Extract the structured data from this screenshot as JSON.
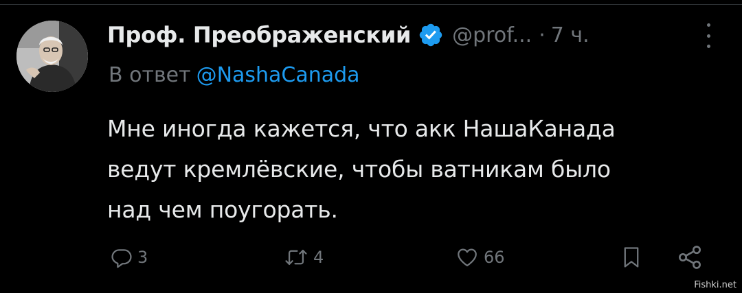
{
  "author": {
    "display_name": "Проф. Преображенский",
    "handle": "@prof...",
    "separator": "·",
    "time_ago": "7 ч.",
    "verified_badge_color": "#1d9bf0"
  },
  "reply_to": {
    "prefix": "В ответ",
    "mention": "@NashaCanada",
    "mention_color": "#1d9bf0"
  },
  "tweet_text_lines": [
    "Мне иногда кажется, что акк НашаКанада",
    "ведут кремлёвские, чтобы ватникам было",
    "над чем поугорать."
  ],
  "actions": {
    "reply_count": "3",
    "retweet_count": "4",
    "like_count": "66"
  },
  "icons": {
    "reply": "reply-icon",
    "retweet": "retweet-icon",
    "like": "heart-icon",
    "bookmark": "bookmark-icon",
    "share": "share-icon",
    "more": "more-vertical-icon",
    "verified": "verified-badge-icon"
  },
  "watermark": "Fishki.net",
  "colors": {
    "background": "#000000",
    "text": "#e7e9ea",
    "muted": "#71767b",
    "accent": "#1d9bf0"
  }
}
